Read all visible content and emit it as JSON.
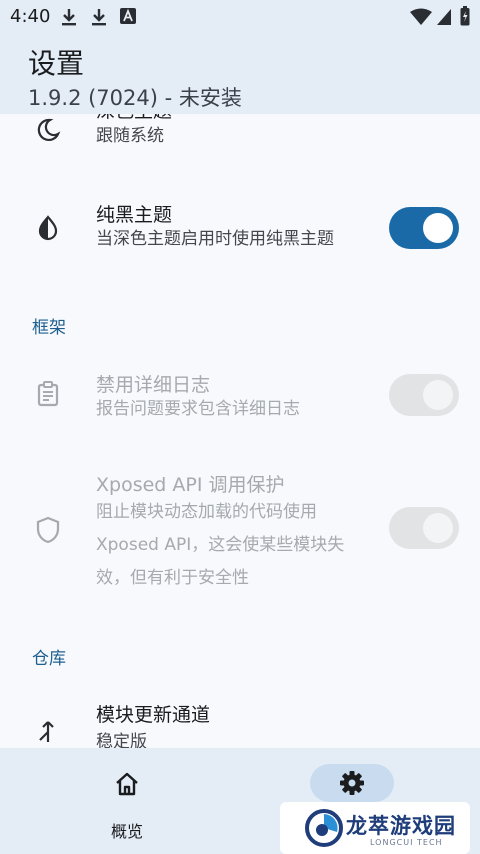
{
  "status_bar": {
    "time": "4:40",
    "icons": [
      "download-icon",
      "download-icon",
      "font-icon",
      "wifi-icon",
      "cellular-signal-icon",
      "battery-icon"
    ]
  },
  "header": {
    "title": "设置",
    "subtitle": "1.9.2 (7024) - 未安装"
  },
  "settings": {
    "dark_theme": {
      "title": "深色主题",
      "summary": "跟随系统",
      "icon": "moon-icon"
    },
    "black_theme": {
      "title": "纯黑主题",
      "summary": "当深色主题启用时使用纯黑主题",
      "icon": "contrast-icon",
      "enabled": true,
      "checked": true
    },
    "section_framework": "框架",
    "verbose_log": {
      "title": "禁用详细日志",
      "summary": "报告问题要求包含详细日志",
      "icon": "clipboard-icon",
      "enabled": false
    },
    "api_protection": {
      "title": "Xposed API 调用保护",
      "summary_line1": "阻止模块动态加载的代码使用",
      "summary_line2": "Xposed API，这会使某些模块失",
      "summary_line3": "效，但有利于安全性",
      "icon": "shield-icon",
      "enabled": false
    },
    "section_repo": "仓库",
    "update_channel": {
      "title": "模块更新通道",
      "summary": "稳定版",
      "icon": "merge-icon"
    }
  },
  "bottom_nav": {
    "items": [
      {
        "label": "概览",
        "icon": "home-icon"
      },
      {
        "label": "",
        "icon": "settings-gear-icon",
        "selected": true
      }
    ]
  },
  "watermark": {
    "text": "龙萃游戏园",
    "sub": "LONGCUI TECH"
  },
  "colors": {
    "accent": "#1b6aa8",
    "section": "#1f5f8f",
    "bar_background": "#e4ecf6"
  }
}
